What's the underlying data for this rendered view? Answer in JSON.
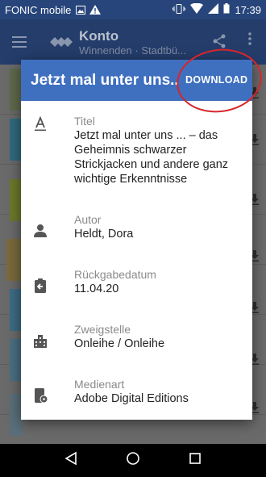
{
  "status_bar": {
    "carrier": "FONIC mobile",
    "time": "17:39"
  },
  "app_bar": {
    "title": "Konto",
    "subtitle": "Winnenden · Stadtbü..."
  },
  "dialog": {
    "title": "Jetzt mal unter uns...",
    "download_label": "DOWNLOAD",
    "fields": [
      {
        "label": "Titel",
        "value": "Jetzt mal unter uns ... – das Geheimnis schwarzer Strickjacken und andere ganz wichtige Erkenntnisse",
        "icon": "text-format-icon"
      },
      {
        "label": "Autor",
        "value": "Heldt, Dora",
        "icon": "person-icon"
      },
      {
        "label": "Rückgabedatum",
        "value": "11.04.20",
        "icon": "assignment-return-icon"
      },
      {
        "label": "Zweigstelle",
        "value": "Onleihe / Onleihe",
        "icon": "building-icon"
      },
      {
        "label": "Medienart",
        "value": "Adobe Digital Editions",
        "icon": "media-type-icon"
      }
    ]
  },
  "colors": {
    "accent": "#3f6fbf",
    "annotation": "#d8252c"
  }
}
